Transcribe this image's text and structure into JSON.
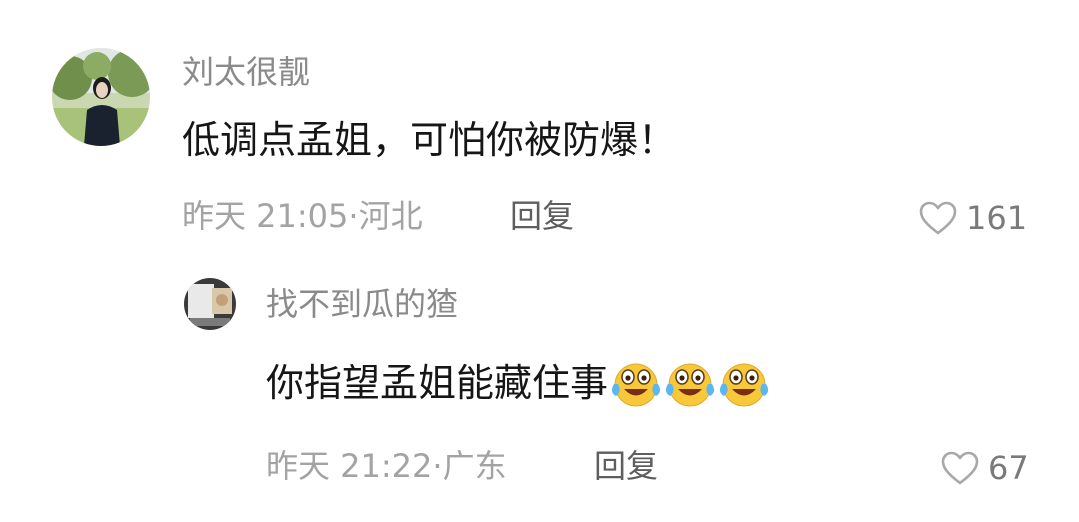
{
  "comments": [
    {
      "username": "刘太很靓",
      "text": "低调点孟姐，可怕你被防爆！",
      "time": "昨天 21:05",
      "separator": "·",
      "location": "河北",
      "reply_label": "回复",
      "like_count": "161",
      "avatar_icon": "avatar-photo"
    },
    {
      "username": "找不到瓜的猹",
      "text": "你指望孟姐能藏住事",
      "emojis": [
        "crying-laughing-emoji",
        "crying-laughing-emoji",
        "crying-laughing-emoji"
      ],
      "time": "昨天 21:22",
      "separator": "·",
      "location": "广东",
      "reply_label": "回复",
      "like_count": "67",
      "avatar_icon": "avatar-photo"
    }
  ],
  "colors": {
    "username": "#8a8a8a",
    "text": "#161616",
    "meta": "#a3a3a3",
    "reply": "#5e5e5e",
    "like": "#7a7a7a",
    "emoji_face": "#f7c93a"
  }
}
